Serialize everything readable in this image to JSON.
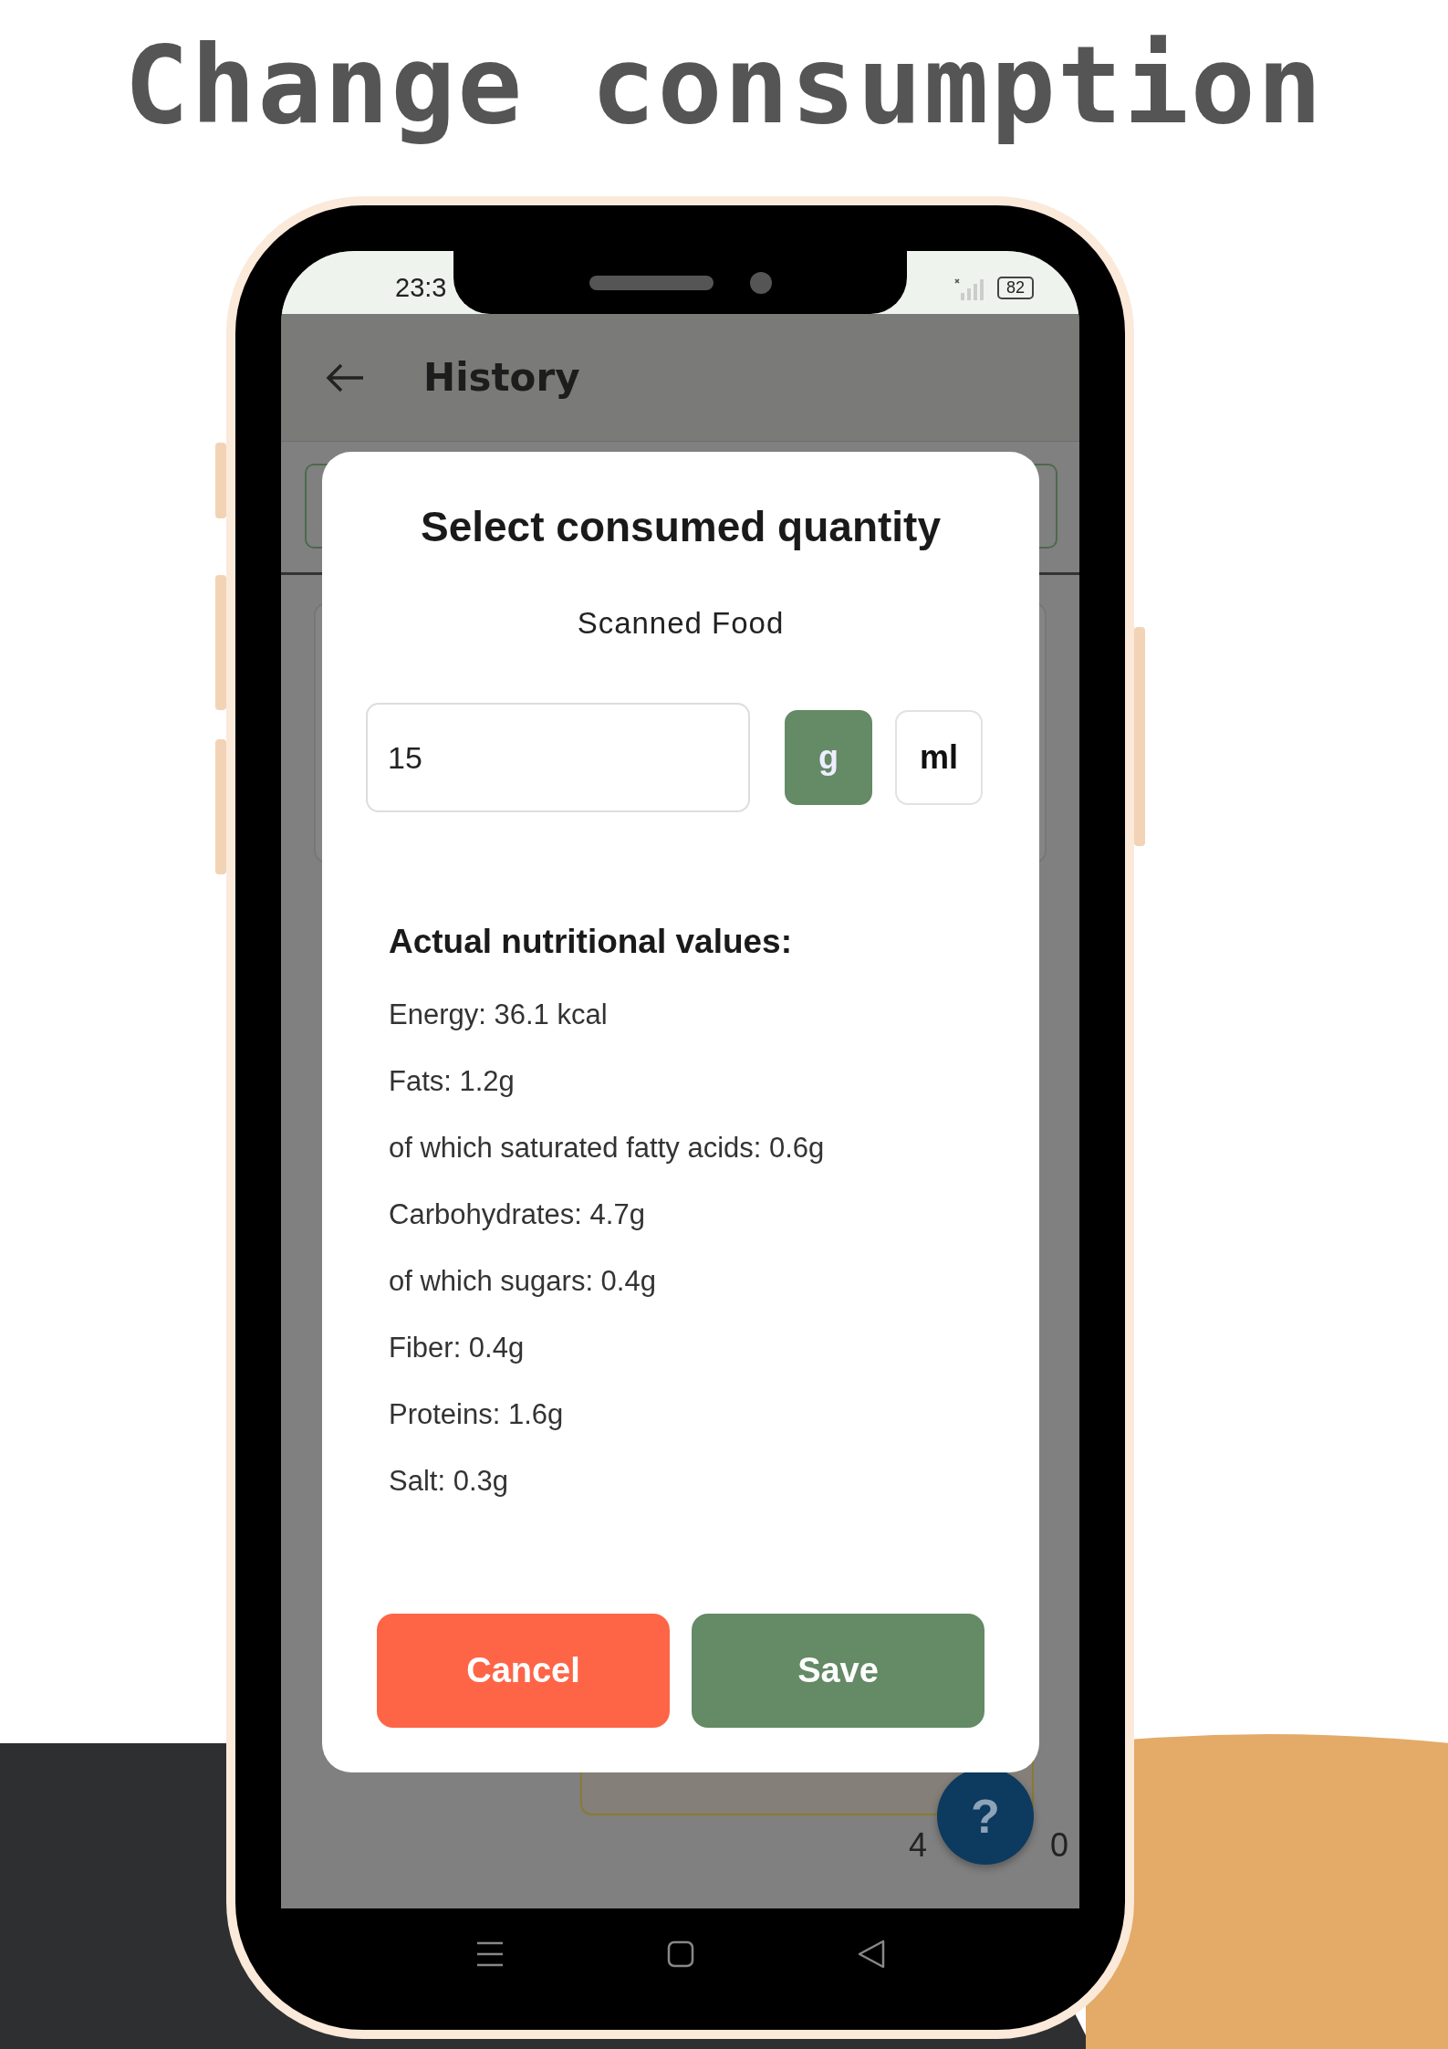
{
  "headline": "Change consumption",
  "status_bar": {
    "time": "23:3",
    "battery": "82"
  },
  "app_bar": {
    "title": "History"
  },
  "background_texts": [
    "4",
    "0"
  ],
  "dialog": {
    "title": "Select consumed quantity",
    "subtitle": "Scanned Food",
    "quantity": {
      "value": "15"
    },
    "units": [
      {
        "label": "g",
        "selected": true
      },
      {
        "label": "ml",
        "selected": false
      }
    ],
    "section_title": "Actual nutritional values:",
    "nutrients": [
      "Energy: 36.1 kcal",
      "Fats: 1.2g",
      "of which saturated fatty acids: 0.6g",
      "Carbohydrates: 4.7g",
      "of which sugars: 0.4g",
      "Fiber: 0.4g",
      "Proteins: 1.6g",
      "Salt: 0.3g"
    ],
    "buttons": [
      {
        "label": "Cancel",
        "kind": "cancel"
      },
      {
        "label": "Save",
        "kind": "save"
      }
    ]
  },
  "help_button": {
    "label": "?"
  }
}
